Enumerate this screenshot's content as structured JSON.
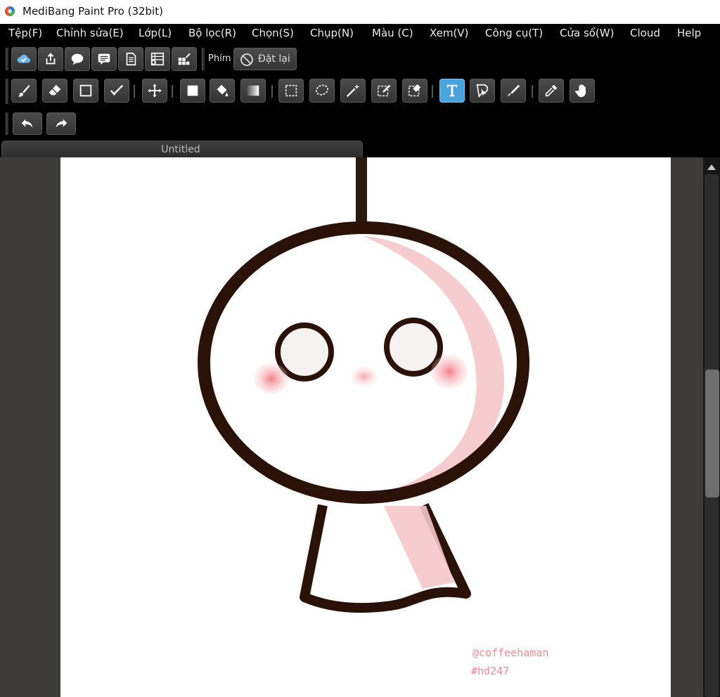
{
  "window": {
    "title": "MediBang Paint Pro (32bit)"
  },
  "menu": [
    {
      "label": "Tệp(F)"
    },
    {
      "label": "Chỉnh sửa(E)"
    },
    {
      "label": "Lớp(L)"
    },
    {
      "label": "Bộ lọc(R)"
    },
    {
      "label": "Chọn(S)"
    },
    {
      "label": "Chụp(N)"
    },
    {
      "label": "Màu (C)"
    },
    {
      "label": "Xem(V)"
    },
    {
      "label": "Công cụ(T)"
    },
    {
      "label": "Cửa sổ(W)"
    },
    {
      "label": "Cloud"
    },
    {
      "label": "Help"
    }
  ],
  "toolbar_top": {
    "icons": [
      "cloud-check-icon",
      "share-icon",
      "chat-bubble-icon",
      "comment-icon",
      "page-icon",
      "layer-panel-icon",
      "tile-icon"
    ],
    "shortcut_label": "Phím",
    "reset_label": "Đặt lại"
  },
  "toolbar_tools": {
    "icons": [
      "brush-icon",
      "eraser-icon",
      "rectangle-icon",
      "check-pen-icon",
      "move-icon",
      "fill-square-icon",
      "bucket-icon",
      "gradient-icon",
      "select-rect-icon",
      "lasso-icon",
      "magic-wand-icon",
      "select-pen-icon",
      "select-eraser-icon",
      "text-icon",
      "pointer-icon",
      "blend-icon",
      "eyedropper-icon",
      "hand-icon"
    ],
    "active_tool": "text-icon",
    "accent_color": "#4aa3dc"
  },
  "toolbar_history": {
    "icons": [
      "undo-icon",
      "redo-icon"
    ]
  },
  "document": {
    "tab_title": "Untitled"
  },
  "canvas": {
    "watermark_line1": "@coffeehaman",
    "watermark_line2": "#hd247",
    "line_color": "#2b1208",
    "blush_color": "#f2a0a8"
  }
}
